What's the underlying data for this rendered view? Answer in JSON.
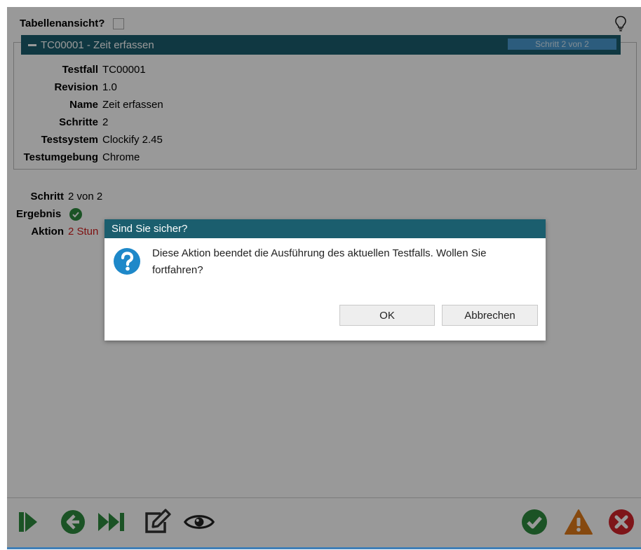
{
  "header": {
    "table_view_label": "Tabellenansicht?"
  },
  "testcase": {
    "panel_title": "TC00001 - Zeit erfassen",
    "step_badge": "Schritt 2 von 2",
    "fields": [
      {
        "label": "Testfall",
        "value": "TC00001"
      },
      {
        "label": "Revision",
        "value": "1.0"
      },
      {
        "label": "Name",
        "value": "Zeit erfassen"
      },
      {
        "label": "Schritte",
        "value": "2"
      },
      {
        "label": "Testsystem",
        "value": "Clockify 2.45"
      },
      {
        "label": "Testumgebung",
        "value": "Chrome"
      }
    ]
  },
  "step": {
    "step_label": "Schritt",
    "step_value": "2 von 2",
    "result_label": "Ergebnis",
    "action_label": "Aktion",
    "action_value": "2 Stun"
  },
  "dialog": {
    "title": "Sind Sie sicher?",
    "message": "Diese Aktion beendet die Ausführung des aktuellen Testfalls. Wollen Sie fortfahren?",
    "ok_label": "OK",
    "cancel_label": "Abbrechen"
  },
  "colors": {
    "header_teal": "#1b5e6e",
    "badge_blue": "#4a9ad0",
    "action_red": "#d21d1d",
    "green": "#2e8b3e",
    "warning_orange": "#e07b1a",
    "error_red": "#d2232a",
    "question_blue": "#1e88c9"
  },
  "toolbar_icons": [
    "step-forward-icon",
    "back-arrow-icon",
    "fast-forward-icon",
    "edit-icon",
    "eye-icon",
    "pass-check-icon",
    "warning-icon",
    "fail-x-icon"
  ]
}
